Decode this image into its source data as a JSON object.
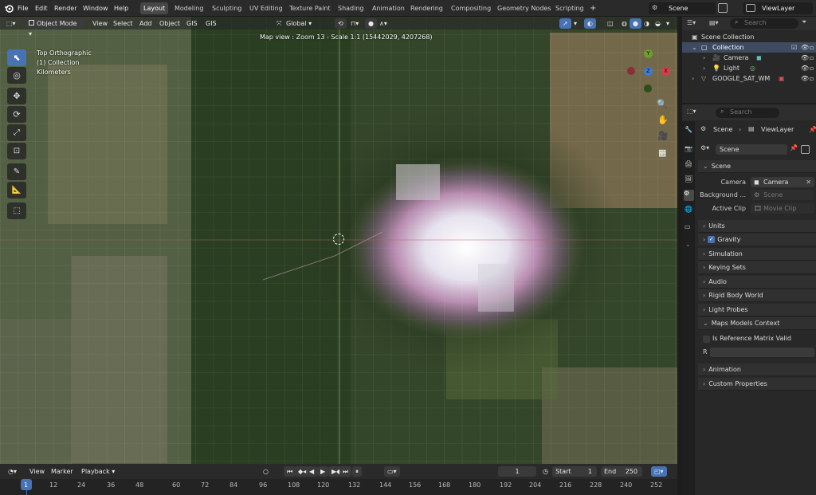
{
  "topbar": {
    "menus": [
      "File",
      "Edit",
      "Render",
      "Window",
      "Help"
    ],
    "workspaces": [
      "Layout",
      "Modeling",
      "Sculpting",
      "UV Editing",
      "Texture Paint",
      "Shading",
      "Animation",
      "Rendering",
      "Compositing",
      "Geometry Nodes",
      "Scripting"
    ],
    "active_workspace": "Layout",
    "add_tab": "+",
    "scene": "Scene",
    "view_layer": "ViewLayer"
  },
  "viewport_header": {
    "mode": "Object Mode",
    "menus": [
      "View",
      "Select",
      "Add",
      "Object",
      "GIS",
      "GIS"
    ],
    "orientation": "Global"
  },
  "viewport": {
    "map_info": "Map view : Zoom 13 - Scale 1:1 (15442029, 4207268)",
    "view_name": "Top Orthographic",
    "collection": "(1) Collection",
    "units": "Kilometers",
    "gizmo_axes": [
      "Y",
      "Z",
      "X"
    ]
  },
  "timeline": {
    "menus": [
      "View",
      "Marker",
      "Playback"
    ],
    "current_frame": "1",
    "start_label": "Start",
    "start": "1",
    "end_label": "End",
    "end": "250",
    "ruler": [
      "1",
      "12",
      "24",
      "36",
      "48",
      "60",
      "72",
      "84",
      "96",
      "108",
      "120",
      "132",
      "144",
      "156",
      "168",
      "180",
      "192",
      "204",
      "216",
      "228",
      "240",
      "252"
    ]
  },
  "outliner": {
    "search_placeholder": "Search",
    "items": [
      {
        "label": "Scene Collection",
        "level": 0
      },
      {
        "label": "Collection",
        "level": 1
      },
      {
        "label": "Camera",
        "level": 2
      },
      {
        "label": "Light",
        "level": 2
      },
      {
        "label": "GOOGLE_SAT_WM",
        "level": 1
      }
    ]
  },
  "properties": {
    "search_placeholder": "Search",
    "breadcrumb": [
      "Scene",
      "ViewLayer"
    ],
    "scene_name": "Scene",
    "scene_panel": "Scene",
    "camera_label": "Camera",
    "camera_value": "Camera",
    "background_label": "Background ...",
    "background_placeholder": "Scene",
    "active_clip_label": "Active Clip",
    "active_clip_placeholder": "Movie Clip",
    "panels": [
      "Units",
      "Gravity",
      "Simulation",
      "Keying Sets",
      "Audio",
      "Rigid Body World",
      "Light Probes",
      "Maps Models Context"
    ],
    "reference_matrix_label": "Is Reference Matrix Valid",
    "r_label": "R",
    "bottom_panels": [
      "Animation",
      "Custom Properties"
    ]
  },
  "colors": {
    "accent": "#4772b3",
    "header_bg": "#2a2a2a",
    "panel_bg": "#282828"
  }
}
